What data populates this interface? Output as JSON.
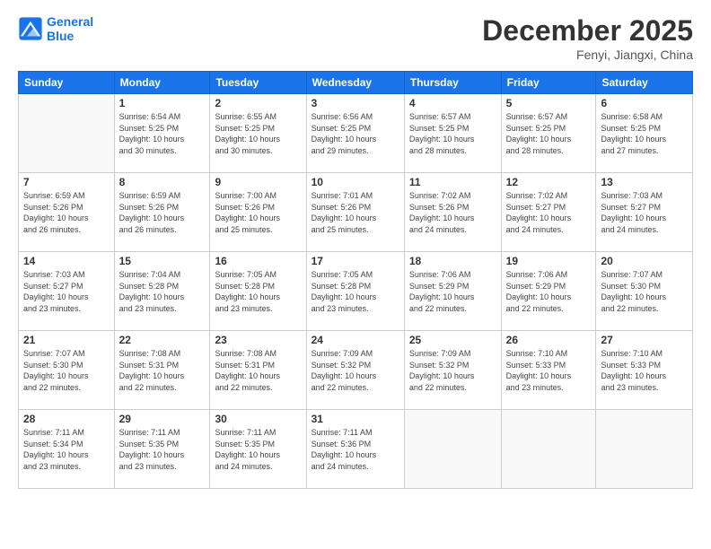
{
  "logo": {
    "line1": "General",
    "line2": "Blue"
  },
  "title": "December 2025",
  "subtitle": "Fenyi, Jiangxi, China",
  "header_days": [
    "Sunday",
    "Monday",
    "Tuesday",
    "Wednesday",
    "Thursday",
    "Friday",
    "Saturday"
  ],
  "weeks": [
    [
      {
        "day": "",
        "info": ""
      },
      {
        "day": "1",
        "info": "Sunrise: 6:54 AM\nSunset: 5:25 PM\nDaylight: 10 hours\nand 30 minutes."
      },
      {
        "day": "2",
        "info": "Sunrise: 6:55 AM\nSunset: 5:25 PM\nDaylight: 10 hours\nand 30 minutes."
      },
      {
        "day": "3",
        "info": "Sunrise: 6:56 AM\nSunset: 5:25 PM\nDaylight: 10 hours\nand 29 minutes."
      },
      {
        "day": "4",
        "info": "Sunrise: 6:57 AM\nSunset: 5:25 PM\nDaylight: 10 hours\nand 28 minutes."
      },
      {
        "day": "5",
        "info": "Sunrise: 6:57 AM\nSunset: 5:25 PM\nDaylight: 10 hours\nand 28 minutes."
      },
      {
        "day": "6",
        "info": "Sunrise: 6:58 AM\nSunset: 5:25 PM\nDaylight: 10 hours\nand 27 minutes."
      }
    ],
    [
      {
        "day": "7",
        "info": "Sunrise: 6:59 AM\nSunset: 5:26 PM\nDaylight: 10 hours\nand 26 minutes."
      },
      {
        "day": "8",
        "info": "Sunrise: 6:59 AM\nSunset: 5:26 PM\nDaylight: 10 hours\nand 26 minutes."
      },
      {
        "day": "9",
        "info": "Sunrise: 7:00 AM\nSunset: 5:26 PM\nDaylight: 10 hours\nand 25 minutes."
      },
      {
        "day": "10",
        "info": "Sunrise: 7:01 AM\nSunset: 5:26 PM\nDaylight: 10 hours\nand 25 minutes."
      },
      {
        "day": "11",
        "info": "Sunrise: 7:02 AM\nSunset: 5:26 PM\nDaylight: 10 hours\nand 24 minutes."
      },
      {
        "day": "12",
        "info": "Sunrise: 7:02 AM\nSunset: 5:27 PM\nDaylight: 10 hours\nand 24 minutes."
      },
      {
        "day": "13",
        "info": "Sunrise: 7:03 AM\nSunset: 5:27 PM\nDaylight: 10 hours\nand 24 minutes."
      }
    ],
    [
      {
        "day": "14",
        "info": "Sunrise: 7:03 AM\nSunset: 5:27 PM\nDaylight: 10 hours\nand 23 minutes."
      },
      {
        "day": "15",
        "info": "Sunrise: 7:04 AM\nSunset: 5:28 PM\nDaylight: 10 hours\nand 23 minutes."
      },
      {
        "day": "16",
        "info": "Sunrise: 7:05 AM\nSunset: 5:28 PM\nDaylight: 10 hours\nand 23 minutes."
      },
      {
        "day": "17",
        "info": "Sunrise: 7:05 AM\nSunset: 5:28 PM\nDaylight: 10 hours\nand 23 minutes."
      },
      {
        "day": "18",
        "info": "Sunrise: 7:06 AM\nSunset: 5:29 PM\nDaylight: 10 hours\nand 22 minutes."
      },
      {
        "day": "19",
        "info": "Sunrise: 7:06 AM\nSunset: 5:29 PM\nDaylight: 10 hours\nand 22 minutes."
      },
      {
        "day": "20",
        "info": "Sunrise: 7:07 AM\nSunset: 5:30 PM\nDaylight: 10 hours\nand 22 minutes."
      }
    ],
    [
      {
        "day": "21",
        "info": "Sunrise: 7:07 AM\nSunset: 5:30 PM\nDaylight: 10 hours\nand 22 minutes."
      },
      {
        "day": "22",
        "info": "Sunrise: 7:08 AM\nSunset: 5:31 PM\nDaylight: 10 hours\nand 22 minutes."
      },
      {
        "day": "23",
        "info": "Sunrise: 7:08 AM\nSunset: 5:31 PM\nDaylight: 10 hours\nand 22 minutes."
      },
      {
        "day": "24",
        "info": "Sunrise: 7:09 AM\nSunset: 5:32 PM\nDaylight: 10 hours\nand 22 minutes."
      },
      {
        "day": "25",
        "info": "Sunrise: 7:09 AM\nSunset: 5:32 PM\nDaylight: 10 hours\nand 22 minutes."
      },
      {
        "day": "26",
        "info": "Sunrise: 7:10 AM\nSunset: 5:33 PM\nDaylight: 10 hours\nand 23 minutes."
      },
      {
        "day": "27",
        "info": "Sunrise: 7:10 AM\nSunset: 5:33 PM\nDaylight: 10 hours\nand 23 minutes."
      }
    ],
    [
      {
        "day": "28",
        "info": "Sunrise: 7:11 AM\nSunset: 5:34 PM\nDaylight: 10 hours\nand 23 minutes."
      },
      {
        "day": "29",
        "info": "Sunrise: 7:11 AM\nSunset: 5:35 PM\nDaylight: 10 hours\nand 23 minutes."
      },
      {
        "day": "30",
        "info": "Sunrise: 7:11 AM\nSunset: 5:35 PM\nDaylight: 10 hours\nand 24 minutes."
      },
      {
        "day": "31",
        "info": "Sunrise: 7:11 AM\nSunset: 5:36 PM\nDaylight: 10 hours\nand 24 minutes."
      },
      {
        "day": "",
        "info": ""
      },
      {
        "day": "",
        "info": ""
      },
      {
        "day": "",
        "info": ""
      }
    ]
  ]
}
